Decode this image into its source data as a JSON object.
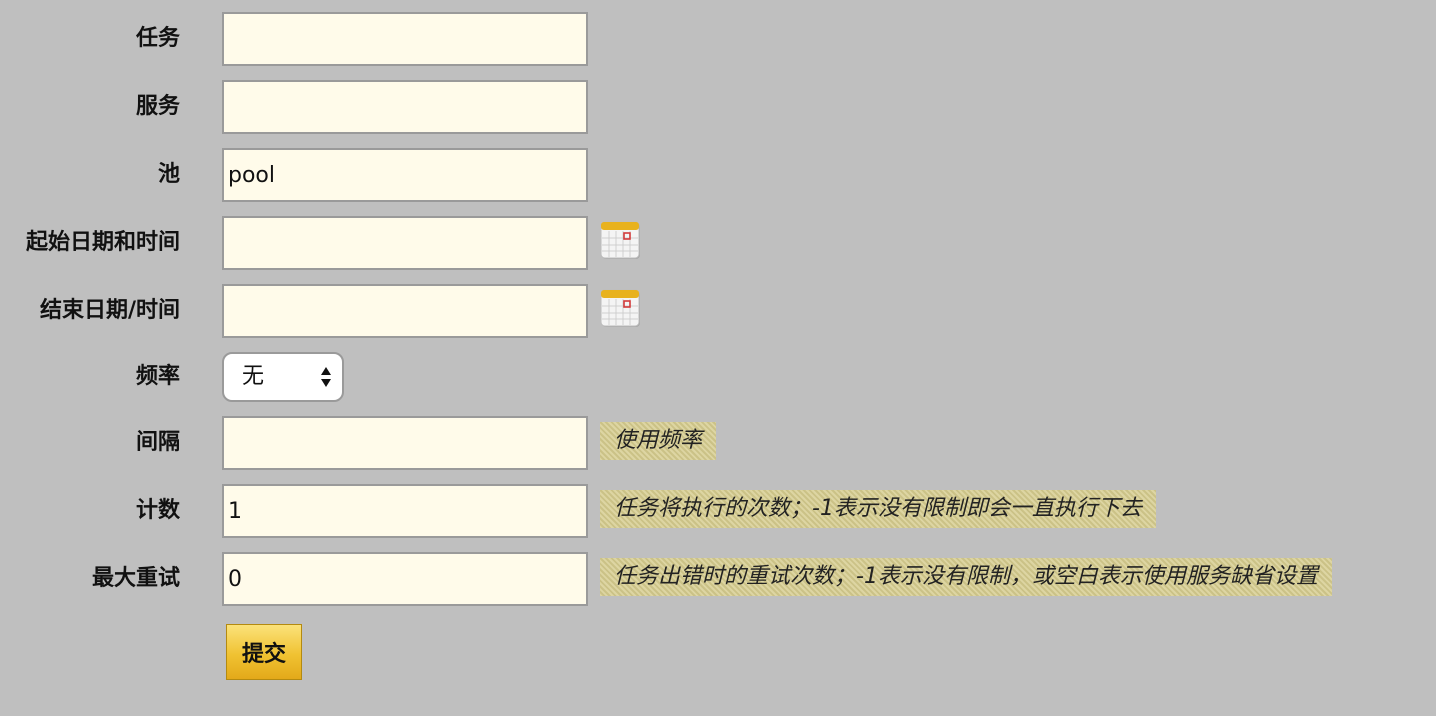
{
  "form": {
    "task": {
      "label": "任务",
      "value": ""
    },
    "service": {
      "label": "服务",
      "value": ""
    },
    "pool": {
      "label": "池",
      "value": "pool"
    },
    "start": {
      "label": "起始日期和时间",
      "value": "",
      "icon": "calendar-icon"
    },
    "end": {
      "label": "结束日期/时间",
      "value": "",
      "icon": "calendar-icon"
    },
    "frequency": {
      "label": "频率",
      "selected": "无"
    },
    "interval": {
      "label": "间隔",
      "value": "",
      "hint": "使用频率"
    },
    "count": {
      "label": "计数",
      "value": "1",
      "hint": "任务将执行的次数；-1表示没有限制即会一直执行下去"
    },
    "max_retry": {
      "label": "最大重试",
      "value": "0",
      "hint": "任务出错时的重试次数；-1表示没有限制，或空白表示使用服务缺省设置"
    },
    "submit_label": "提交"
  },
  "colors": {
    "background": "#bfbfbf",
    "field_bg": "#fffbea",
    "hint_bg": "#d6cc8e",
    "button": "#f0c232"
  }
}
